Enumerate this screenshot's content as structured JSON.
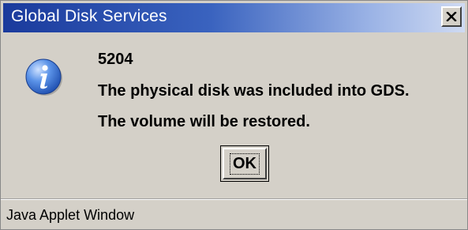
{
  "window": {
    "title": "Global Disk Services",
    "close_icon": "close-icon"
  },
  "message": {
    "icon": "info-icon",
    "code": "5204",
    "line1": "The physical disk was included into GDS.",
    "line2": "The volume will be restored."
  },
  "buttons": {
    "ok_label": "OK"
  },
  "status": {
    "text": "Java Applet Window"
  },
  "colors": {
    "title_bar_start": "#1a3a9c",
    "title_bar_end": "#cfdaf2",
    "dialog_background": "#d4d0c8",
    "info_icon_blue": "#1f5fc8"
  }
}
